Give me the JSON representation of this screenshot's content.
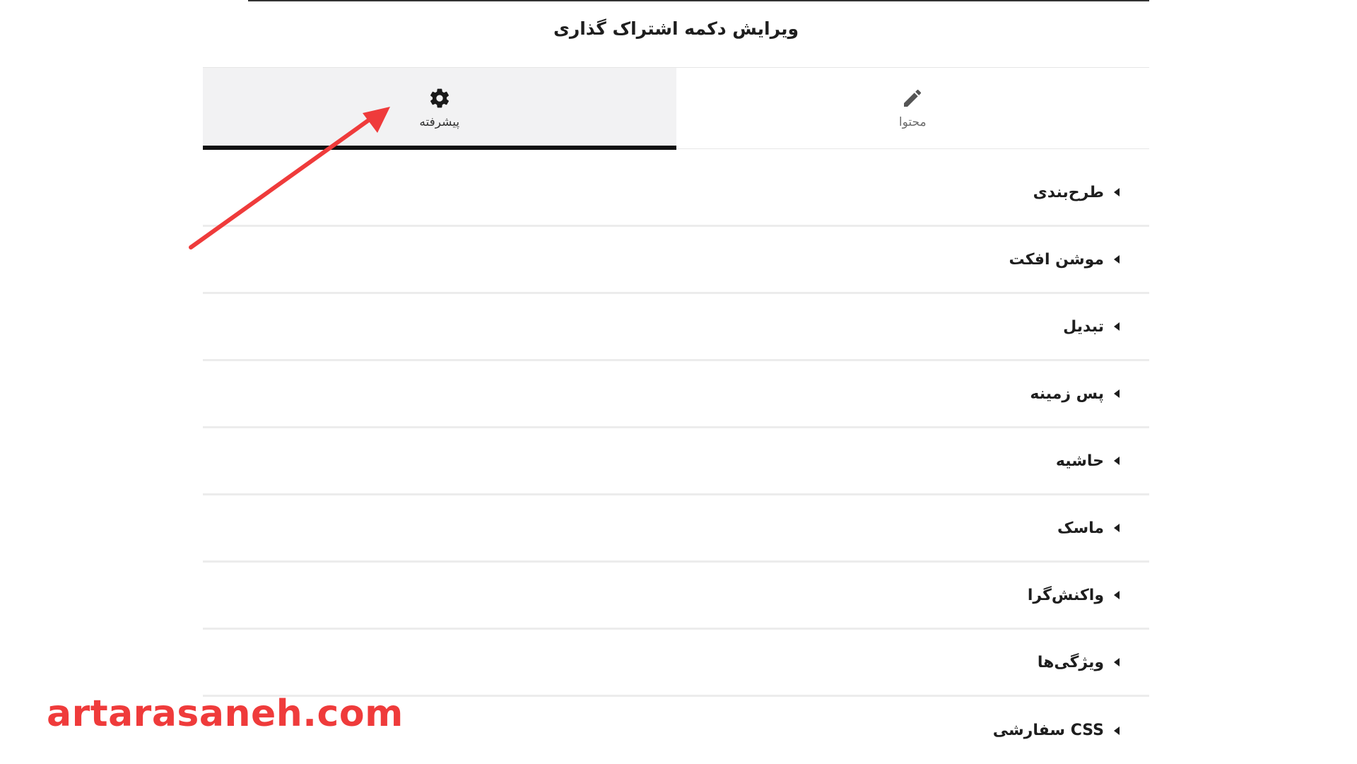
{
  "panel": {
    "title": "ویرایش دکمه اشتراک گذاری"
  },
  "tabs": [
    {
      "label": "پیشرفته",
      "icon": "gear-icon",
      "active": true
    },
    {
      "label": "محتوا",
      "icon": "pencil-icon",
      "active": false
    }
  ],
  "sections": [
    {
      "label": "طرح‌بندی"
    },
    {
      "label": "موشن افکت"
    },
    {
      "label": "تبدیل"
    },
    {
      "label": "پس زمینه"
    },
    {
      "label": "حاشیه"
    },
    {
      "label": "ماسک"
    },
    {
      "label": "واکنش‌گرا"
    },
    {
      "label": "ویژگی‌ها"
    },
    {
      "label": "CSS سفارشی"
    }
  ],
  "watermark": {
    "text": "artarasaneh.com",
    "color": "#ef3b3b"
  },
  "colors": {
    "annotation_arrow": "#ef3b3b",
    "active_tab_bg": "#f2f2f3",
    "active_tab_indicator": "#111111"
  }
}
